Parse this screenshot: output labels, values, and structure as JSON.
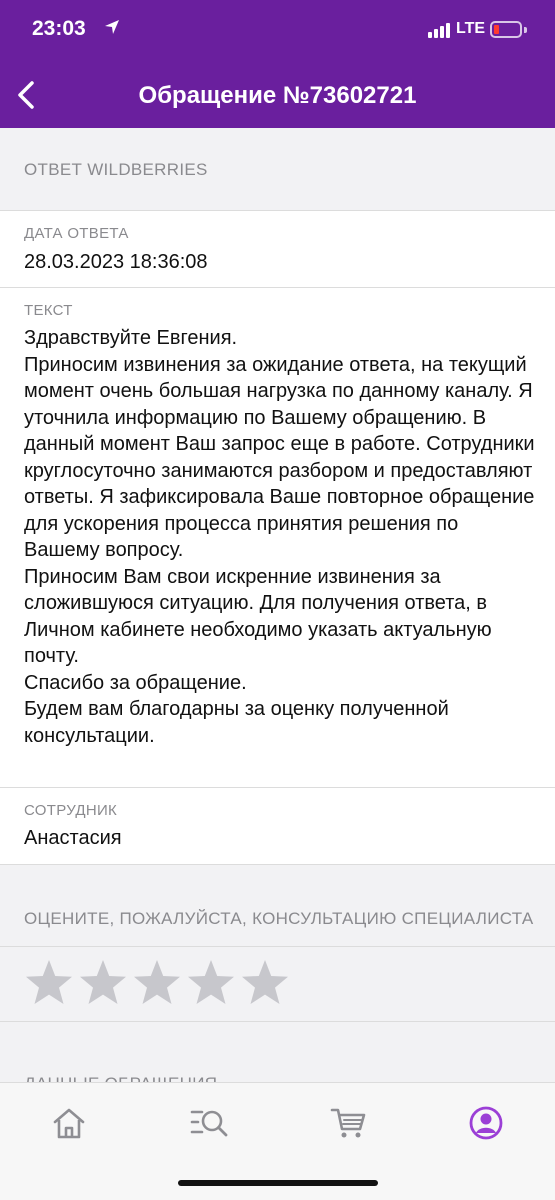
{
  "status": {
    "time": "23:03",
    "network": "LTE",
    "icons": [
      "location-arrow-icon",
      "signal-bars-icon",
      "battery-low-icon"
    ]
  },
  "header": {
    "title": "Обращение №73602721",
    "back_icon": "chevron-left-icon",
    "background": "#6a1f9e"
  },
  "response": {
    "section_title": "ОТВЕТ WILDBERRIES",
    "date_label": "ДАТА ОТВЕТА",
    "date_value": "28.03.2023 18:36:08",
    "text_label": "ТЕКСТ",
    "text_value": "Здравствуйте Евгения.\nПриносим извинения за ожидание  ответа, на текущий момент очень большая нагрузка по данному каналу. Я уточнила информацию по Вашему обращению. В данный момент Ваш запрос еще в работе. Сотрудники круглосуточно занимаются разбором и предоставляют ответы. Я зафиксировала Ваше повторное обращение для ускорения процесса принятия решения по Вашему вопросу.\nПриносим Вам свои искренние извинения за сложившуюся ситуацию. Для получения ответа, в Личном кабинете необходимо указать актуальную почту.\nСпасибо за обращение.\nБудем вам благодарны за оценку полученной консультации.",
    "employee_label": "СОТРУДНИК",
    "employee_value": "Анастасия"
  },
  "rating": {
    "title": "ОЦЕНИТЕ, ПОЖАЛУЙСТА, КОНСУЛЬТАЦИЮ СПЕЦИАЛИСТА",
    "max_stars": 5,
    "selected": 0,
    "star_color": "#c7c7cc"
  },
  "request_data": {
    "section_title": "ДАННЫЕ ОБРАЩЕНИЯ"
  },
  "tab_bar": {
    "tabs": [
      {
        "icon": "home-icon",
        "active": false
      },
      {
        "icon": "catalog-search-icon",
        "active": false
      },
      {
        "icon": "cart-icon",
        "active": false
      },
      {
        "icon": "profile-icon",
        "active": true
      }
    ],
    "active_color": "#9b3fd6",
    "inactive_color": "#8e8e93"
  }
}
